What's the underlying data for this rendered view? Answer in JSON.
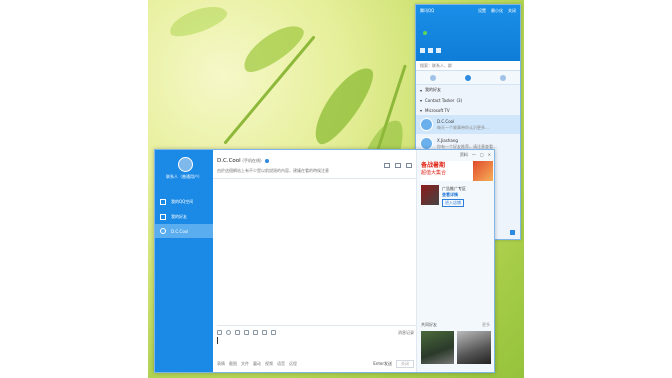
{
  "contact_list": {
    "title": "腾讯QQ",
    "window_controls": [
      "设置",
      "最小化",
      "关闭"
    ],
    "nickname": "",
    "search_placeholder": "搜索：联系人、群",
    "groups": [
      "我的好友",
      "Contact Tasker",
      "Microsoft TV"
    ],
    "group_counts": [
      "",
      "(3)",
      ""
    ],
    "contacts": [
      {
        "name": "D.C.Cool",
        "signature": "每天一个故事带你认识更多..."
      },
      {
        "name": "X.Jiashang",
        "signature": "你有一个好友推荐，请注意查看..."
      }
    ]
  },
  "chat_window": {
    "sidebar_username": "联系人（普通用户）",
    "nav_items": [
      "我的QQ空间",
      "我的好友",
      "D.C.Cool"
    ],
    "title": "D.C.Cool",
    "title_suffix": "(手机在线)",
    "signature": "由於這個網站上有不少是以前說過的內容，建議在看的時候注意",
    "toolbar_history": "消息记录",
    "bottom_links": [
      "表情",
      "截图",
      "文件",
      "震动",
      "视频",
      "语音",
      "远程"
    ],
    "send_label": "Enter发送",
    "send_option": "关闭"
  },
  "side_panel": {
    "window_controls": [
      "资料",
      "一",
      "□",
      "×"
    ],
    "ad_line1": "备战暑期",
    "ad_line2": "超值大集合",
    "card_name": "广告推广专区",
    "card_link": "查看详情",
    "card_button": "进入店铺",
    "photos_heading": "共同好友",
    "photos_more": "更多",
    "bg_label": "Tasker"
  }
}
